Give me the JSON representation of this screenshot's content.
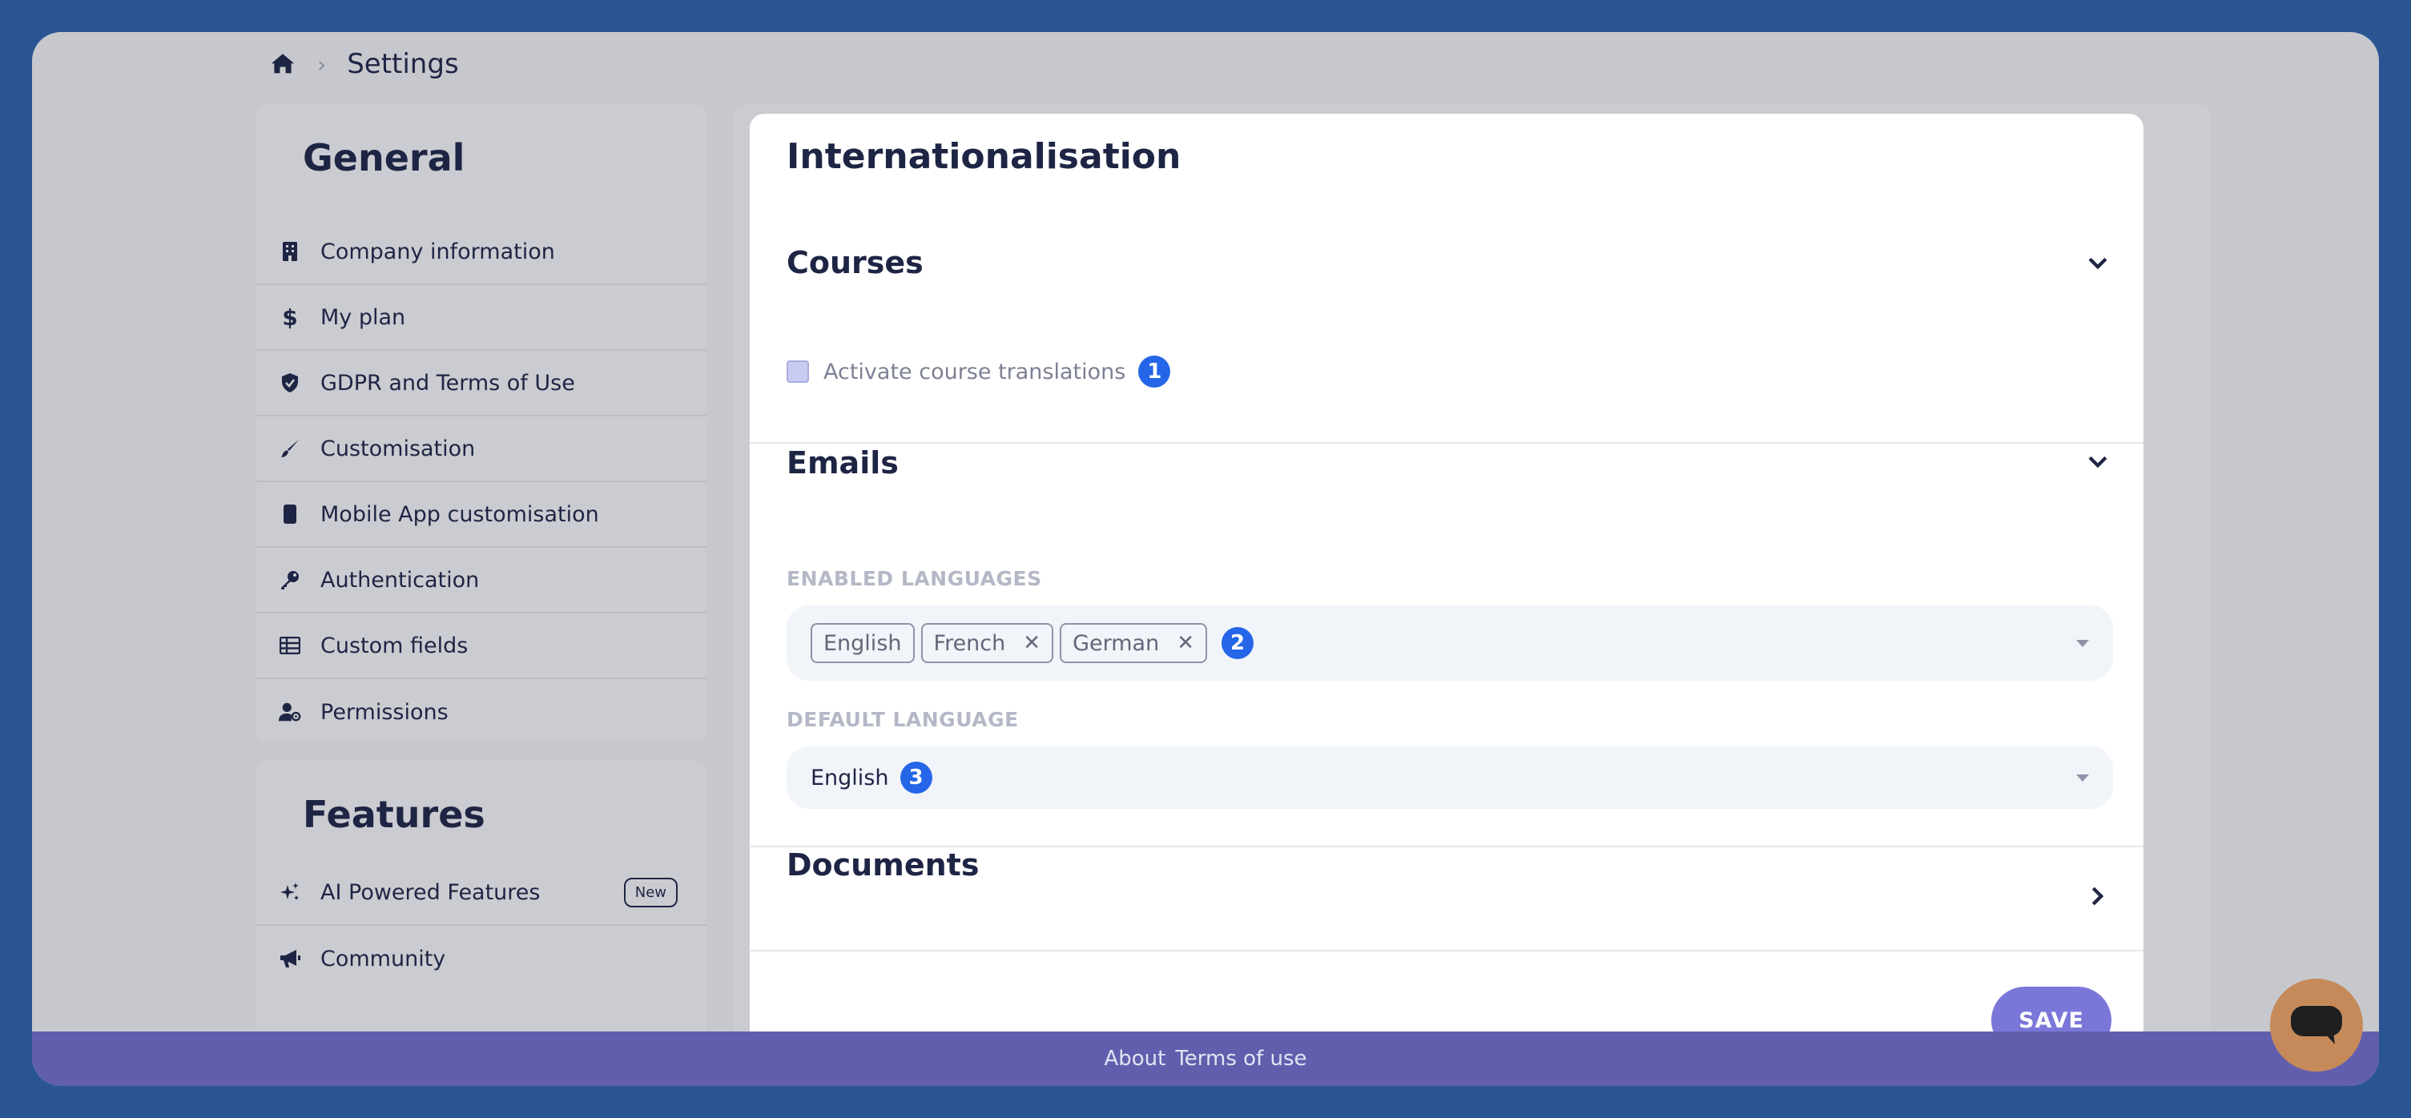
{
  "breadcrumb": {
    "title": "Settings"
  },
  "sidebar": {
    "general": {
      "heading": "General",
      "items": [
        {
          "label": "Company information",
          "icon": "building-icon"
        },
        {
          "label": "My plan",
          "icon": "dollar-icon"
        },
        {
          "label": "GDPR and Terms of Use",
          "icon": "shield-check-icon"
        },
        {
          "label": "Customisation",
          "icon": "brush-icon"
        },
        {
          "label": "Mobile App customisation",
          "icon": "mobile-icon"
        },
        {
          "label": "Authentication",
          "icon": "key-icon"
        },
        {
          "label": "Custom fields",
          "icon": "table-icon"
        },
        {
          "label": "Permissions",
          "icon": "user-gear-icon"
        }
      ]
    },
    "features": {
      "heading": "Features",
      "items": [
        {
          "label": "AI Powered Features",
          "icon": "sparkles-icon",
          "badge": "New"
        },
        {
          "label": "Community",
          "icon": "megaphone-icon"
        }
      ]
    }
  },
  "main": {
    "title": "Internationalisation",
    "courses": {
      "heading": "Courses",
      "checkbox_label": "Activate course translations",
      "checkbox_checked": false,
      "marker": "1"
    },
    "emails": {
      "heading": "Emails",
      "enabled_label": "ENABLED LANGUAGES",
      "enabled_languages": [
        "English",
        "French",
        "German"
      ],
      "marker_enabled": "2",
      "default_label": "DEFAULT LANGUAGE",
      "default_value": "English",
      "marker_default": "3"
    },
    "documents": {
      "heading": "Documents"
    },
    "save_label": "SAVE"
  },
  "footer": {
    "about": "About",
    "terms": "Terms of use"
  },
  "colors": {
    "background": "#2a5593",
    "accent": "#7b77d9",
    "badge": "#2566e8",
    "footer": "#615fad",
    "chat": "#c68a5a"
  }
}
